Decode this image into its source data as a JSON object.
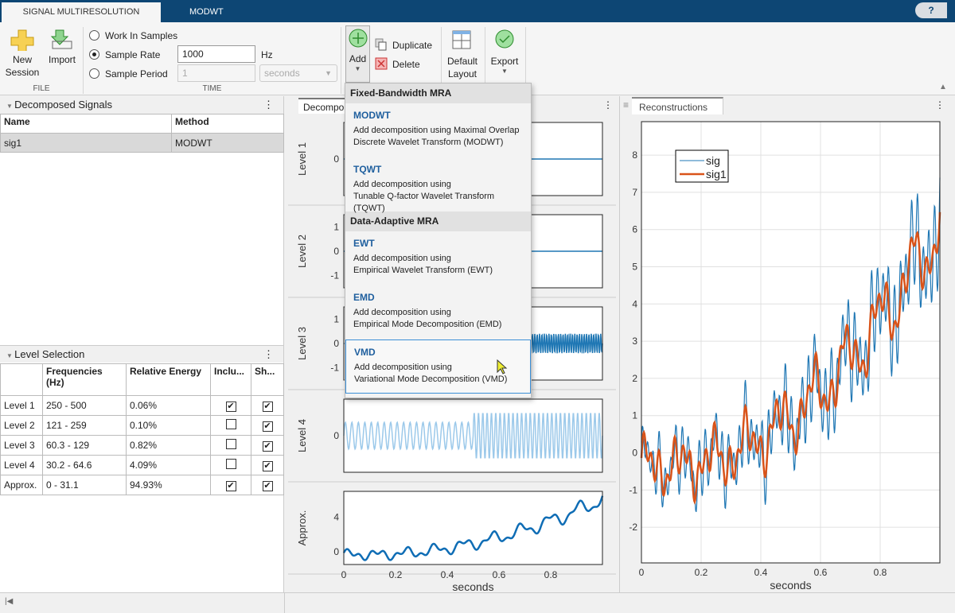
{
  "app": {
    "tabs": [
      {
        "label": "SIGNAL MULTIRESOLUTION ANALYZER",
        "active": true
      },
      {
        "label": "MODWT",
        "active": false
      }
    ],
    "help": "?"
  },
  "toolstrip": {
    "file": {
      "new_session": "New\nSession",
      "new1": "New",
      "new2": "Session",
      "import": "Import",
      "section": "FILE"
    },
    "time": {
      "work_in_samples": "Work In Samples",
      "sample_rate": "Sample Rate",
      "sample_rate_value": "1000",
      "hz": "Hz",
      "sample_period": "Sample Period",
      "sample_period_value": "1",
      "period_unit": "seconds",
      "section": "TIME",
      "selected": "Sample Rate"
    },
    "add": "Add",
    "duplicate": "Duplicate",
    "delete": "Delete",
    "default1": "Default",
    "default2": "Layout",
    "export": "Export"
  },
  "add_menu": {
    "groups": [
      {
        "title": "Fixed-Bandwidth MRA",
        "items": [
          {
            "title": "MODWT",
            "l1": "Add decomposition using Maximal Overlap",
            "l2": "Discrete Wavelet Transform (MODWT)"
          },
          {
            "title": "TQWT",
            "l1": "Add decomposition using",
            "l2": "Tunable Q-factor Wavelet Transform (TQWT)"
          }
        ]
      },
      {
        "title": "Data-Adaptive MRA",
        "items": [
          {
            "title": "EWT",
            "l1": "Add decomposition using",
            "l2": "Empirical Wavelet Transform (EWT)"
          },
          {
            "title": "EMD",
            "l1": "Add decomposition using",
            "l2": "Empirical Mode Decomposition (EMD)"
          },
          {
            "title": "VMD",
            "l1": "Add decomposition using",
            "l2": "Variational Mode Decomposition (VMD)",
            "hovered": true
          }
        ]
      }
    ]
  },
  "decomposed": {
    "title": "Decomposed Signals",
    "columns": [
      "Name",
      "Method"
    ],
    "rows": [
      [
        "sig1",
        "MODWT"
      ]
    ]
  },
  "levels": {
    "title": "Level Selection",
    "columns": [
      "",
      "Frequencies\n(Hz)",
      "Relative Energy",
      "Inclu...",
      "Sh..."
    ],
    "col1a": "Frequencies",
    "col1b": "(Hz)",
    "rows": [
      {
        "name": "Level 1",
        "freq": "250 - 500",
        "energy": "0.06%",
        "include": true,
        "show": true
      },
      {
        "name": "Level 2",
        "freq": "121 - 259",
        "energy": "0.10%",
        "include": false,
        "show": true
      },
      {
        "name": "Level 3",
        "freq": "60.3 - 129",
        "energy": "0.82%",
        "include": false,
        "show": true
      },
      {
        "name": "Level 4",
        "freq": "30.2 - 64.6",
        "energy": "4.09%",
        "include": false,
        "show": true
      },
      {
        "name": "Approx.",
        "freq": "0 - 31.1",
        "energy": "94.93%",
        "include": true,
        "show": true
      }
    ]
  },
  "decomp_panel": {
    "tab": "Decompo",
    "xlabel": "seconds",
    "xticks": [
      "0",
      "0.2",
      "0.4",
      "0.6",
      "0.8"
    ],
    "plots": [
      {
        "label": "Level 1",
        "yticks": [
          "0"
        ]
      },
      {
        "label": "Level 2",
        "yticks": [
          "1",
          "0",
          "-1"
        ]
      },
      {
        "label": "Level 3",
        "yticks": [
          "1",
          "0",
          "-1"
        ]
      },
      {
        "label": "Level 4",
        "yticks": [
          "0"
        ]
      },
      {
        "label": "Approx.",
        "yticks": [
          "4",
          "0"
        ]
      }
    ]
  },
  "recon_panel": {
    "tab": "Reconstructions",
    "xlabel": "seconds",
    "xticks": [
      "0",
      "0.2",
      "0.4",
      "0.6",
      "0.8"
    ],
    "yticks": [
      "8",
      "7",
      "6",
      "5",
      "4",
      "3",
      "2",
      "1",
      "0",
      "-1",
      "-2"
    ],
    "legend": [
      "sig",
      "sig1"
    ]
  },
  "colors": {
    "sig": "#1f77b4",
    "sig1": "#d95319",
    "toolbar_blue": "#0d4674"
  }
}
